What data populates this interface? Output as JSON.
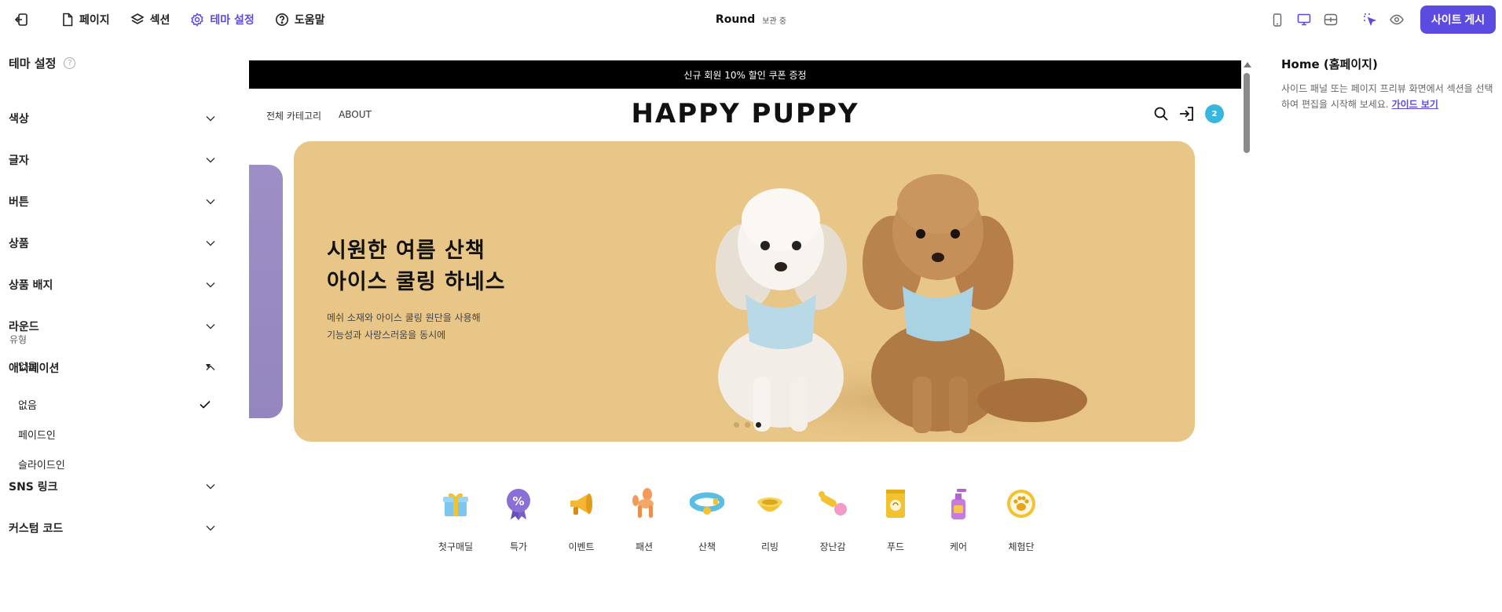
{
  "topbar": {
    "nav": [
      {
        "label": "페이지",
        "icon": "file-icon"
      },
      {
        "label": "섹션",
        "icon": "layers-icon"
      },
      {
        "label": "테마 설정",
        "icon": "gear-icon"
      },
      {
        "label": "도움말",
        "icon": "help-icon"
      }
    ],
    "site_title": "Round",
    "save_status": "보관 중",
    "publish_label": "사이트 게시"
  },
  "left_panel": {
    "title": "테마 설정",
    "sections": [
      {
        "label": "색상"
      },
      {
        "label": "글자"
      },
      {
        "label": "버튼"
      },
      {
        "label": "상품"
      },
      {
        "label": "상품 배지"
      },
      {
        "label": "라운드"
      },
      {
        "label": "애니메이션"
      },
      {
        "label": "SNS 링크"
      },
      {
        "label": "커스텀 코드"
      }
    ],
    "animation": {
      "type_label": "유형",
      "selected": "없음",
      "options": [
        "없음",
        "페이드인",
        "슬라이드인"
      ]
    }
  },
  "preview": {
    "announcement": "신규 회원 10% 할인 쿠폰 증정",
    "nav": [
      "전체 카테고리",
      "ABOUT"
    ],
    "logo": "HAPPY PUPPY",
    "cart_count": "2",
    "banner": {
      "headline_line1": "시원한 여름 산책",
      "headline_line2": "아이스 쿨링 하네스",
      "desc_line1": "메쉬 소재와 아이스 쿨링 원단을 사용해",
      "desc_line2": "기능성과 사랑스러움을 동시에",
      "slide_count": 3,
      "active_slide": 3
    },
    "categories": [
      {
        "label": "첫구매딜",
        "icon": "gift-icon"
      },
      {
        "label": "특가",
        "icon": "percent-badge-icon"
      },
      {
        "label": "이벤트",
        "icon": "megaphone-icon"
      },
      {
        "label": "패션",
        "icon": "balloon-dog-icon"
      },
      {
        "label": "산책",
        "icon": "collar-icon"
      },
      {
        "label": "리빙",
        "icon": "bowl-icon"
      },
      {
        "label": "장난감",
        "icon": "toy-icon"
      },
      {
        "label": "푸드",
        "icon": "food-bag-icon"
      },
      {
        "label": "케어",
        "icon": "pump-bottle-icon"
      },
      {
        "label": "체험단",
        "icon": "paw-icon"
      }
    ]
  },
  "right_panel": {
    "title": "Home (홈페이지)",
    "desc": "사이드 패널 또는 페이지 프리뷰 화면에서 섹션을 선택하여 편집을 시작해 보세요.",
    "link": "가이드 보기"
  },
  "colors": {
    "accent": "#5b4be0",
    "banner_bg": "#e8c687",
    "badge": "#38b6e0"
  }
}
